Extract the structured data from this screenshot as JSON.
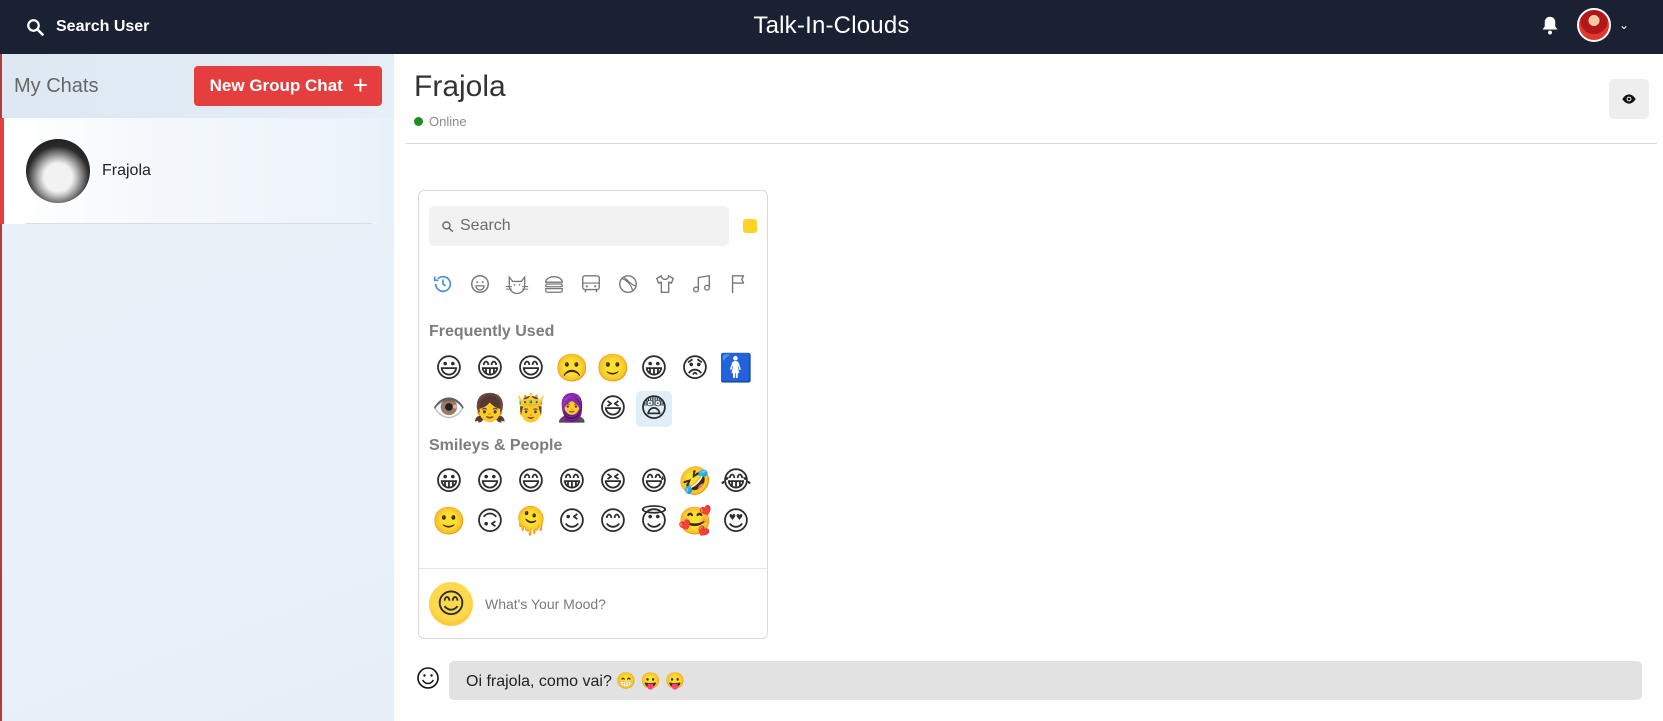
{
  "topbar": {
    "search_label": "Search User",
    "app_title": "Talk-In-Clouds",
    "icons": [
      "search-icon",
      "bell-icon",
      "user-avatar",
      "chevron-down-icon"
    ]
  },
  "sidebar": {
    "title": "My Chats",
    "new_group_label": "New Group Chat",
    "new_group_icon": "+",
    "chats": [
      {
        "name": "Frajola"
      }
    ]
  },
  "chat": {
    "title": "Frajola",
    "status": "Online",
    "status_color": "#1e8c1e"
  },
  "emoji_picker": {
    "search_placeholder": "Search",
    "skin_tone_color": "#ffd225",
    "categories": [
      "clock-icon",
      "smiley-icon",
      "cat-icon",
      "burger-icon",
      "bus-icon",
      "ball-icon",
      "shirt-icon",
      "music-icon",
      "flag-icon"
    ],
    "frequently_used_title": "Frequently Used",
    "frequently_used": [
      "😃",
      "😁",
      "😄",
      "☹️",
      "🙂",
      "😀",
      "😟",
      "🚺",
      "👁️",
      "👧",
      "🤴",
      "🧕",
      "😆",
      "😨"
    ],
    "smileys_title": "Smileys & People",
    "smileys": [
      "😀",
      "😃",
      "😄",
      "😁",
      "😆",
      "😅",
      "🤣",
      "😂",
      "🙂",
      "🙃",
      "🫠",
      "😉",
      "😊",
      "😇",
      "🥰",
      "😍"
    ],
    "footer_emoji": "😊",
    "footer_text": "What's Your Mood?"
  },
  "message_input": {
    "value": "Oi frajola, como vai? 😁 😛 😛"
  },
  "colors": {
    "topbar_bg": "#1a2133",
    "accent_red": "#e53e3e"
  }
}
